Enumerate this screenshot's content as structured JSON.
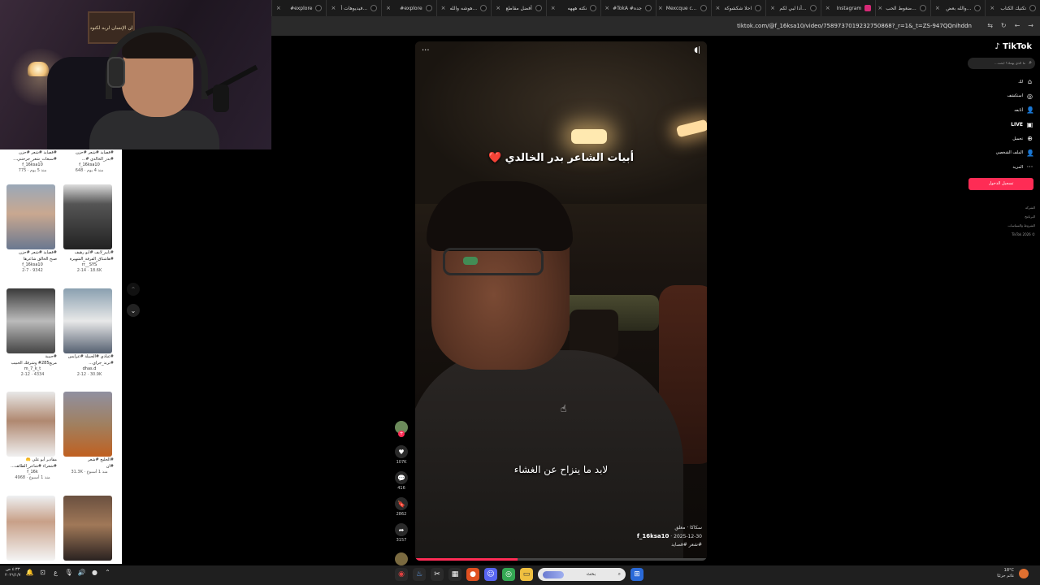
{
  "browser": {
    "tabs": [
      {
        "title": "تكتيك الكتاب",
        "icon": "tiktok-icon"
      },
      {
        "title": "والله بعض...",
        "icon": "tiktok-icon"
      },
      {
        "title": "ضغوط الحب...",
        "icon": "tiktok-icon"
      },
      {
        "title": "Instagram",
        "icon": "instagram-icon"
      },
      {
        "title": "أذا لبي لكم...",
        "icon": "tiktok-icon"
      },
      {
        "title": "احلا شكشوكة",
        "icon": "tiktok-icon"
      },
      {
        "title": "Mexcque c...",
        "icon": "tiktok-icon"
      },
      {
        "title": "#TokA #جده",
        "icon": "tiktok-icon"
      },
      {
        "title": "نكته هههه",
        "icon": "tiktok-icon"
      },
      {
        "title": "أفضل مقاطع",
        "icon": "tiktok-icon"
      },
      {
        "title": "هوشه والله...",
        "icon": "tiktok-icon"
      },
      {
        "title": "#explore",
        "icon": "tiktok-icon"
      },
      {
        "title": "فيديوهات أ...",
        "icon": "tiktok-icon"
      },
      {
        "title": "#explore",
        "icon": "tiktok-icon"
      }
    ],
    "tab_close": "×",
    "url": "tiktok.com/@f_16ksa10/video/7589737019232750868?_r=1&_t=ZS-947QQnihddn",
    "nav_back": "←",
    "nav_forward": "→",
    "nav_reload": "↻",
    "ext_icon": "⇆"
  },
  "webcam": {
    "sign_text": "ان الإنسان لربه لكنود"
  },
  "profile_grid": [
    {
      "caption": "#قصايد #شعر #حزن",
      "caption2": "#سبعات_شعر_جرحتني...",
      "user": "f_16ksa10",
      "stats": "775 · منذ 5 يوم",
      "col": 0,
      "row": 0,
      "theme": "none"
    },
    {
      "caption": "#قصايد #شعر #حزن",
      "caption2": "#بدر_الخالدي #...",
      "user": "f_16ksa10",
      "stats": "648 · منذ 4 يوم",
      "col": 1,
      "row": 0,
      "theme": "none"
    },
    {
      "caption": "#قصايد #شعر #حزن",
      "caption2": "صبح الخالق شاعرها",
      "user": "f_16ksa10",
      "stats": "2-7 · 9342",
      "col": 0,
      "row": 1,
      "theme": "face"
    },
    {
      "caption": "#تايم_لايف #ابو رهيف",
      "caption2": "#هاشتاق_الفرقة_الشهيرة",
      "user": "rr__SYS",
      "stats": "2-14 · 18.6K",
      "col": 1,
      "row": 1,
      "theme": "dark"
    },
    {
      "caption": "#حبيبة",
      "caption2": "مربع285# وشرقك الحبيب",
      "user": "m_7_k_t",
      "stats": "2-12 · 4334",
      "col": 0,
      "row": 2,
      "theme": "group"
    },
    {
      "caption": "#عبادي #الجبيلة #عرايس",
      "caption2": "#ترند_جراي...",
      "user": "dhas.d",
      "stats": "2-12 · 30.9K",
      "col": 1,
      "row": 2,
      "theme": "group2"
    },
    {
      "caption": "مقادير أبو علي 🤲",
      "caption2": "#شعراء #شاعر_الطائف...",
      "user": "f_16k",
      "stats": "4968 · منذ 1 أسبوع",
      "col": 0,
      "row": 3,
      "theme": "smile"
    },
    {
      "caption": "#الخليج #شعر",
      "caption2": "#ان",
      "user": "",
      "stats": "31.3K · منذ 1 أسبوع",
      "col": 1,
      "row": 3,
      "theme": "desert"
    },
    {
      "caption": "",
      "caption2": "",
      "user": "",
      "stats": "",
      "col": 0,
      "row": 4,
      "theme": "white"
    },
    {
      "caption": "",
      "caption2": "",
      "user": "",
      "stats": "",
      "col": 1,
      "row": 4,
      "theme": "beanie"
    }
  ],
  "grid_nav": {
    "up": "⌃",
    "down": "⌄"
  },
  "video": {
    "title": "أبيات الشاعر بدر الخالدي",
    "title_emoji": "❤️",
    "caption": "لابد ما ينزاح عن الغشاء",
    "username": "f_16ksa10",
    "date": "2025-12-30",
    "subtitle": "سكاكا · معلق",
    "hashtags": "#شعر #قصايد",
    "menu": "···",
    "sound": "◖|",
    "progress_fraction": 0.35,
    "progress_color": "#fe2c55"
  },
  "actions": [
    {
      "name": "like",
      "icon": "♥",
      "count": "107K"
    },
    {
      "name": "comment",
      "icon": "💬",
      "count": "416"
    },
    {
      "name": "bookmark",
      "icon": "🔖",
      "count": "2862"
    },
    {
      "name": "share",
      "icon": "➦",
      "count": "3157"
    }
  ],
  "tiktok_sidebar": {
    "logo": "TikTok",
    "search_placeholder": "ما الذي يهمك؟ ابحث...",
    "menu": [
      {
        "label": "لك",
        "icon": "⌂"
      },
      {
        "label": "استكشف",
        "icon": "◎"
      },
      {
        "label": "أتابعه",
        "icon": "👤"
      },
      {
        "label": "LIVE",
        "icon": "▣"
      },
      {
        "label": "تحميل",
        "icon": "⊕"
      },
      {
        "label": "الملف الشخصي",
        "icon": "👤"
      },
      {
        "label": "المزيد",
        "icon": "···"
      }
    ],
    "login": "تسجيل الدخول",
    "footer": [
      "الشركة",
      "البرنامج",
      "الشروط والسياسات",
      "© TikTok 2026"
    ]
  },
  "taskbar": {
    "clock_time": "٤:٣٣ ص",
    "clock_date": "٢٠٢٦/١/٧",
    "lang": "ع",
    "search_label": "بحث",
    "weather_temp": "18°C",
    "weather_desc": "غائم جزئيًا",
    "apps": [
      "start",
      "explorer",
      "chrome",
      "files",
      "discord",
      "firefox",
      "obs",
      "media",
      "steam",
      "obs2"
    ]
  }
}
